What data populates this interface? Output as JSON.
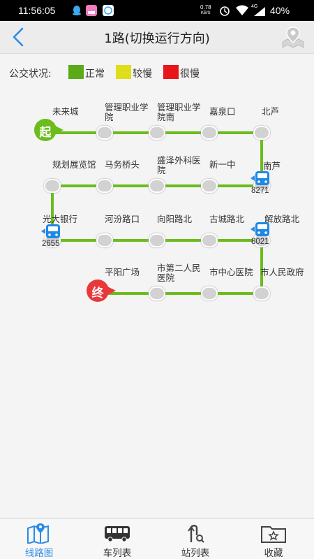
{
  "status_bar": {
    "time": "11:56:05",
    "net_speed": "0.78",
    "net_unit": "KB/S",
    "signal": "4G",
    "battery": "40%"
  },
  "header": {
    "title": "1路(切换运行方向)"
  },
  "legend": {
    "label": "公交状况:",
    "items": [
      {
        "text": "正常",
        "color": "#5aaa1a"
      },
      {
        "text": "较慢",
        "color": "#dede1a"
      },
      {
        "text": "很慢",
        "color": "#e8161a"
      }
    ]
  },
  "route": {
    "line_color": "#6cbc1c",
    "start_marker": "起",
    "end_marker": "终",
    "stops": [
      {
        "name": "未来城"
      },
      {
        "name": "管理职业学\n院"
      },
      {
        "name": "管理职业学\n院南"
      },
      {
        "name": "嘉泉口"
      },
      {
        "name": "北芦"
      },
      {
        "name": "南芦"
      },
      {
        "name": "新一中"
      },
      {
        "name": "盛泽外科医\n院"
      },
      {
        "name": "马务桥头"
      },
      {
        "name": "规划展览馆"
      },
      {
        "name": "光大银行"
      },
      {
        "name": "河汾路口"
      },
      {
        "name": "向阳路北"
      },
      {
        "name": "古城路北"
      },
      {
        "name": "解放路北"
      },
      {
        "name": "市人民政府"
      },
      {
        "name": "市中心医院"
      },
      {
        "name": "市第二人民\n医院"
      },
      {
        "name": "平阳广场"
      }
    ],
    "buses": [
      {
        "id": "8271"
      },
      {
        "id": "2655"
      },
      {
        "id": "8021"
      }
    ]
  },
  "bottom_nav": {
    "items": [
      {
        "label": "线路图",
        "icon": "map-icon"
      },
      {
        "label": "车列表",
        "icon": "bus-icon"
      },
      {
        "label": "站列表",
        "icon": "stop-list-icon"
      },
      {
        "label": "收藏",
        "icon": "favorite-folder-icon"
      }
    ]
  }
}
